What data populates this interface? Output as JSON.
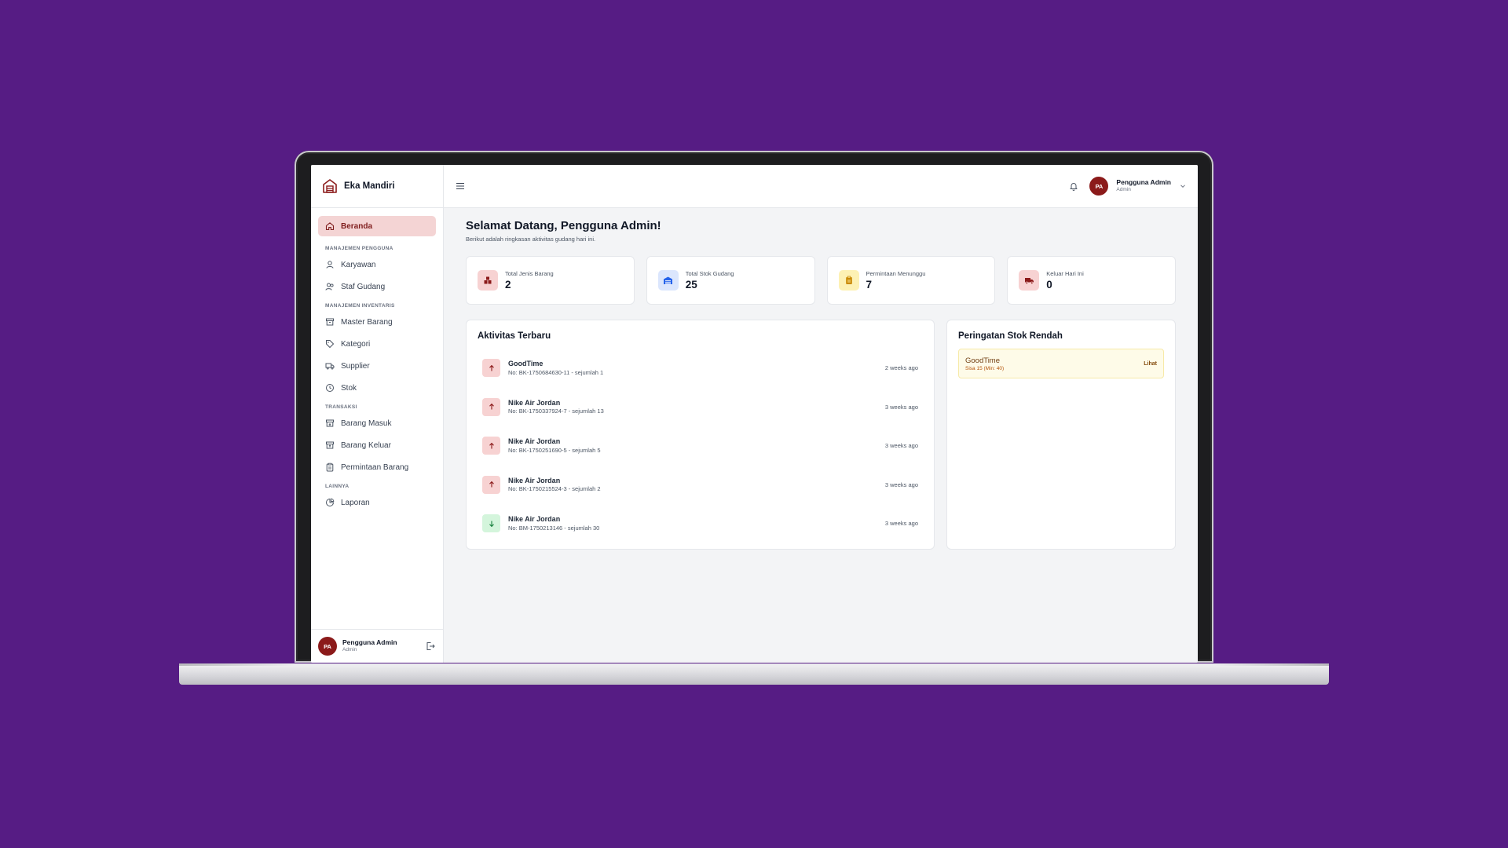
{
  "app": {
    "name": "Eka Mandiri"
  },
  "sidebar": {
    "items": [
      {
        "label": "Beranda",
        "icon": "home-icon",
        "active": true
      }
    ],
    "sections": [
      {
        "title": "MANAJEMEN PENGGUNA",
        "items": [
          {
            "label": "Karyawan",
            "icon": "user-icon"
          },
          {
            "label": "Staf Gudang",
            "icon": "users-icon"
          }
        ]
      },
      {
        "title": "MANAJEMEN INVENTARIS",
        "items": [
          {
            "label": "Master Barang",
            "icon": "archive-icon"
          },
          {
            "label": "Kategori",
            "icon": "tag-icon"
          },
          {
            "label": "Supplier",
            "icon": "truck-icon"
          },
          {
            "label": "Stok",
            "icon": "clock-icon"
          }
        ]
      },
      {
        "title": "TRANSAKSI",
        "items": [
          {
            "label": "Barang Masuk",
            "icon": "inbox-in-icon"
          },
          {
            "label": "Barang Keluar",
            "icon": "inbox-out-icon"
          },
          {
            "label": "Permintaan Barang",
            "icon": "clipboard-icon"
          }
        ]
      },
      {
        "title": "LAINNYA",
        "items": [
          {
            "label": "Laporan",
            "icon": "chart-pie-icon"
          }
        ]
      }
    ],
    "footer": {
      "initials": "PA",
      "name": "Pengguna Admin",
      "role": "Admin"
    }
  },
  "topbar": {
    "initials": "PA",
    "name": "Pengguna Admin",
    "role": "Admin"
  },
  "main": {
    "title": "Selamat Datang, Pengguna Admin!",
    "subtitle": "Berikut adalah ringkasan aktivitas gudang hari ini.",
    "stats": [
      {
        "label": "Total Jenis Barang",
        "value": "2",
        "icon": "boxes-icon",
        "bg": "#f7d2d2",
        "color": "#8b1a1a"
      },
      {
        "label": "Total Stok Gudang",
        "value": "25",
        "icon": "warehouse-icon",
        "bg": "#dbe6fd",
        "color": "#2563eb"
      },
      {
        "label": "Permintaan Menunggu",
        "value": "7",
        "icon": "clipboard-icon",
        "bg": "#fdf1b4",
        "color": "#ca8a04"
      },
      {
        "label": "Keluar Hari Ini",
        "value": "0",
        "icon": "truck-icon",
        "bg": "#f7d2d2",
        "color": "#8b1a1a"
      }
    ],
    "activity": {
      "title": "Aktivitas Terbaru",
      "items": [
        {
          "name": "GoodTime",
          "desc": "No: BK-1750684630-11 - sejumlah 1",
          "time": "2 weeks ago",
          "direction": "out"
        },
        {
          "name": "Nike Air Jordan",
          "desc": "No: BK-1750337924-7 - sejumlah 13",
          "time": "3 weeks ago",
          "direction": "out"
        },
        {
          "name": "Nike Air Jordan",
          "desc": "No: BK-1750251690-5 - sejumlah 5",
          "time": "3 weeks ago",
          "direction": "out"
        },
        {
          "name": "Nike Air Jordan",
          "desc": "No: BK-1750215524-3 - sejumlah 2",
          "time": "3 weeks ago",
          "direction": "out"
        },
        {
          "name": "Nike Air Jordan",
          "desc": "No: BM-1750213146 - sejumlah 30",
          "time": "3 weeks ago",
          "direction": "in"
        }
      ]
    },
    "low_stock": {
      "title": "Peringatan Stok Rendah",
      "items": [
        {
          "name": "GoodTime",
          "desc": "Sisa 15 (Min: 40)",
          "link": "Lihat"
        }
      ]
    }
  }
}
